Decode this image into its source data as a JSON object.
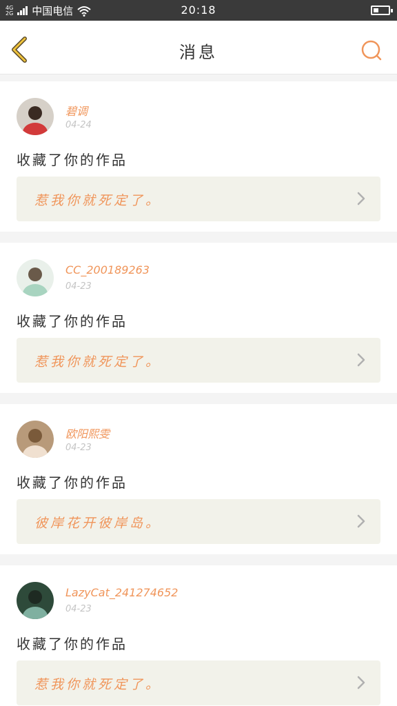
{
  "status_bar": {
    "network_top": "4G",
    "network_bottom": "2G",
    "carrier": "中国电信",
    "time": "20:18",
    "battery_level": 0.3
  },
  "nav": {
    "title": "消息",
    "back_icon": "chevron-left-icon",
    "search_icon": "search-icon"
  },
  "colors": {
    "accent": "#f0955a",
    "back_icon": "#f0c43c",
    "work_box_bg": "#f2f2ea"
  },
  "messages": [
    {
      "user": "碧调",
      "date": "04-24",
      "action": "收藏了你的作品",
      "work_title": "惹我你就死定了。"
    },
    {
      "user": "CC_200189263",
      "date": "04-23",
      "action": "收藏了你的作品",
      "work_title": "惹我你就死定了。"
    },
    {
      "user": "欧阳熙雯",
      "date": "04-23",
      "action": "收藏了你的作品",
      "work_title": "彼岸花开彼岸岛。"
    },
    {
      "user": "LazyCat_241274652",
      "date": "04-23",
      "action": "收藏了你的作品",
      "work_title": "惹我你就死定了。"
    }
  ]
}
